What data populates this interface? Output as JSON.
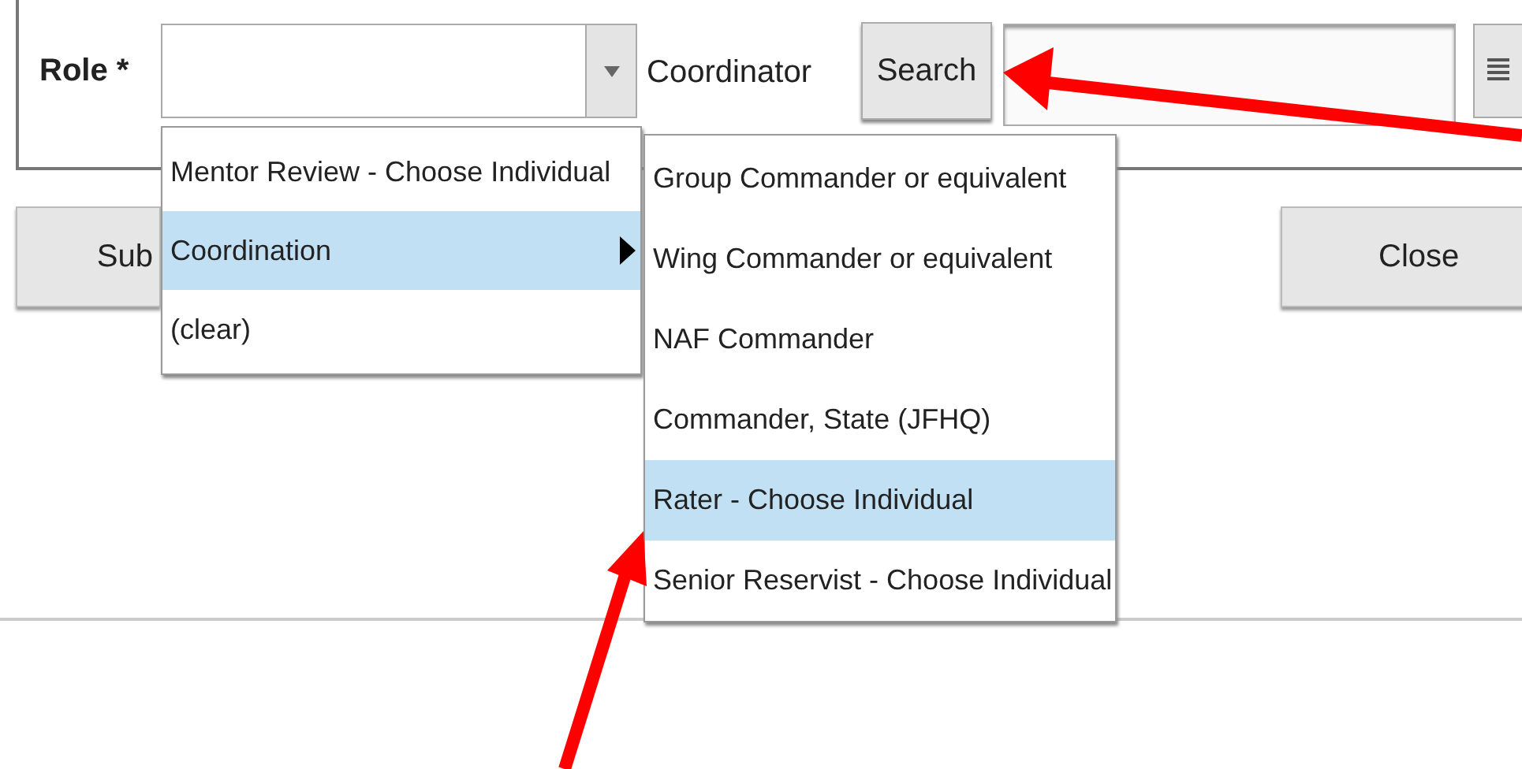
{
  "form": {
    "role_label": "Role *",
    "coordinator_label": "Coordinator",
    "search_button": "Search"
  },
  "buttons": [
    {
      "label": "Sub",
      "kind": "submit"
    },
    {
      "label": "Close",
      "kind": "close"
    }
  ],
  "menu": {
    "items": [
      {
        "label": "Mentor Review - Choose Individual",
        "selected": false,
        "has_submenu": false
      },
      {
        "label": "Coordination",
        "selected": true,
        "has_submenu": true
      },
      {
        "label": "(clear)",
        "selected": false,
        "has_submenu": false
      }
    ]
  },
  "submenu": {
    "items": [
      {
        "label": "Group Commander or equivalent",
        "selected": false
      },
      {
        "label": "Wing Commander or equivalent",
        "selected": false
      },
      {
        "label": "NAF Commander",
        "selected": false
      },
      {
        "label": "Commander, State (JFHQ)",
        "selected": false
      },
      {
        "label": "Rater - Choose Individual",
        "selected": true
      },
      {
        "label": "Senior Reservist - Choose Individual",
        "selected": false
      }
    ]
  }
}
